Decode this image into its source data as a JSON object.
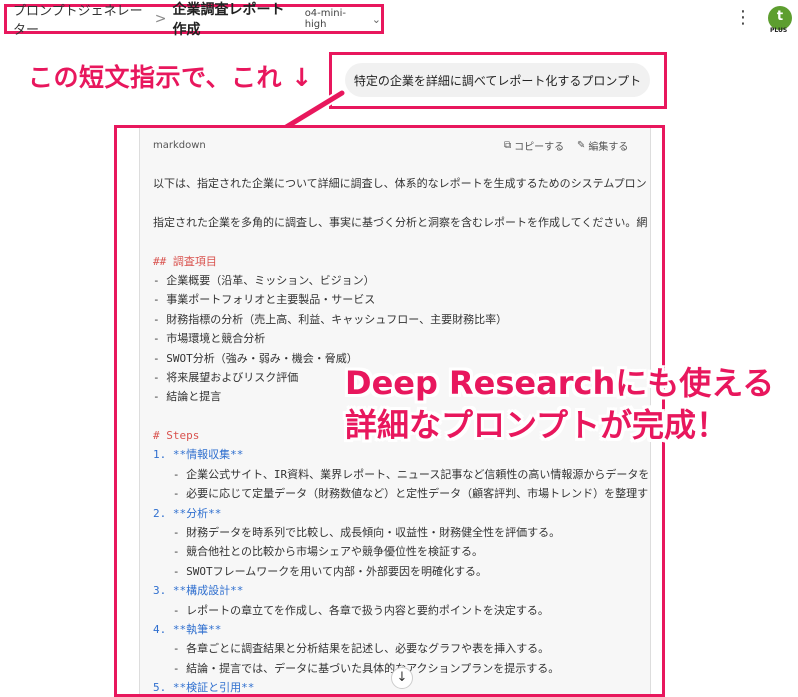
{
  "breadcrumb": {
    "app": "プロンプトジェネレーター",
    "separator": ">",
    "title": "企業調査レポート作成",
    "model": "o4-mini-high"
  },
  "header": {
    "menu_icon": "kebab-icon",
    "avatar_letter": "t",
    "avatar_badge": "PLUS",
    "avatar_color": "#5d9e2f"
  },
  "annotations": {
    "short_instruction": "この短文指示で、これ ↓",
    "result_line1": "Deep Researchにも使える",
    "result_line2": "詳細なプロンプトが完成！",
    "accent_color": "#e8175d"
  },
  "prompt": {
    "text": "特定の企業を詳細に調べてレポート化するプロンプト"
  },
  "code_block": {
    "language": "markdown",
    "copy_label": "コピーする",
    "edit_label": "編集する",
    "lines": [
      {
        "text": "以下は、指定された企業について詳細に調査し、体系的なレポートを生成するためのシステムプロン",
        "style": ""
      },
      {
        "text": "",
        "style": ""
      },
      {
        "text": "指定された企業を多角的に調査し、事実に基づく分析と洞察を含むレポートを作成してください。網",
        "style": ""
      },
      {
        "text": "",
        "style": ""
      },
      {
        "text": "## 調査項目",
        "style": "hdr"
      },
      {
        "text": "- 企業概要（沿革、ミッション、ビジョン）",
        "style": ""
      },
      {
        "text": "- 事業ポートフォリオと主要製品・サービス",
        "style": ""
      },
      {
        "text": "- 財務指標の分析（売上高、利益、キャッシュフロー、主要財務比率）",
        "style": ""
      },
      {
        "text": "- 市場環境と競合分析",
        "style": ""
      },
      {
        "text": "- SWOT分析（強み・弱み・機会・脅威）",
        "style": ""
      },
      {
        "text": "- 将来展望およびリスク評価",
        "style": ""
      },
      {
        "text": "- 結論と提言",
        "style": ""
      },
      {
        "text": "",
        "style": ""
      },
      {
        "text": "# Steps",
        "style": "hdr"
      },
      {
        "text": "1. **情報収集**",
        "style": "num"
      },
      {
        "text": "   - 企業公式サイト、IR資料、業界レポート、ニュース記事など信頼性の高い情報源からデータを",
        "style": ""
      },
      {
        "text": "   - 必要に応じて定量データ（財務数値など）と定性データ（顧客評判、市場トレンド）を整理す",
        "style": ""
      },
      {
        "text": "2. **分析**",
        "style": "num"
      },
      {
        "text": "   - 財務データを時系列で比較し、成長傾向・収益性・財務健全性を評価する。",
        "style": ""
      },
      {
        "text": "   - 競合他社との比較から市場シェアや競争優位性を検証する。",
        "style": ""
      },
      {
        "text": "   - SWOTフレームワークを用いて内部・外部要因を明確化する。",
        "style": ""
      },
      {
        "text": "3. **構成設計**",
        "style": "num"
      },
      {
        "text": "   - レポートの章立てを作成し、各章で扱う内容と要約ポイントを決定する。",
        "style": ""
      },
      {
        "text": "4. **執筆**",
        "style": "num"
      },
      {
        "text": "   - 各章ごとに調査結果と分析結果を記述し、必要なグラフや表を挿入する。",
        "style": ""
      },
      {
        "text": "   - 結論・提言では、データに基づいた具体的なアクションプランを提示する。",
        "style": ""
      },
      {
        "text": "5. **検証と引用**",
        "style": "num"
      }
    ]
  },
  "scroll_down": "↓"
}
